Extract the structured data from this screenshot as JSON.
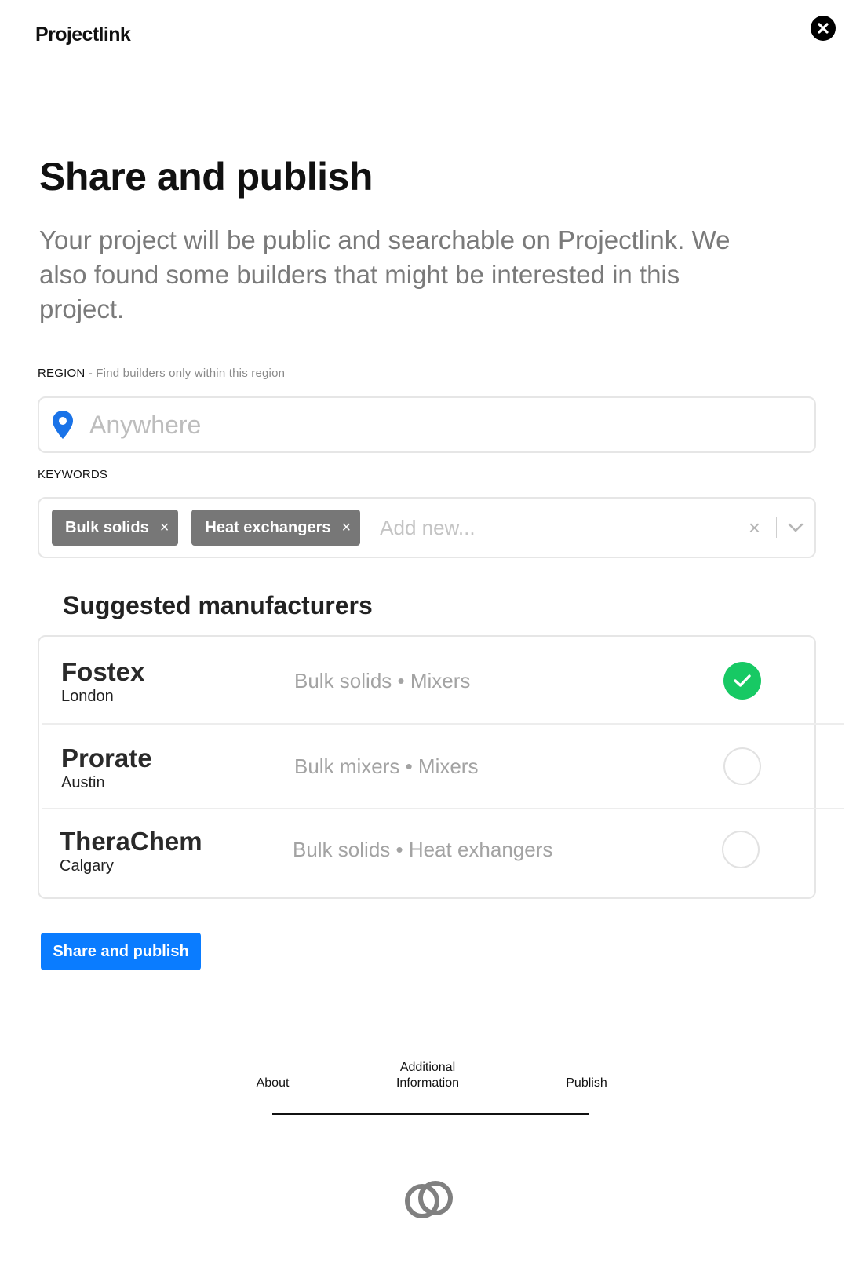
{
  "header": {
    "brand": "Projectlink",
    "close_icon": "close-circle-icon"
  },
  "page": {
    "title": "Share and publish",
    "subtitle": "Your project will be public and searchable on Projectlink. We also found some builders that might be interested in this project."
  },
  "region": {
    "label": "REGION",
    "hint": " - Find builders only within this region",
    "placeholder": "Anywhere",
    "value": "",
    "icon": "location-pin-icon"
  },
  "keywords": {
    "label": "KEYWORDS",
    "chips": [
      "Bulk solids",
      "Heat exchangers"
    ],
    "chip_remove": "×",
    "placeholder": "Add new...",
    "clear": "×"
  },
  "suggested": {
    "title": "Suggested manufacturers",
    "items": [
      {
        "name": "Fostex",
        "city": "London",
        "tags": "Bulk solids • Mixers",
        "selected": true
      },
      {
        "name": "Prorate",
        "city": "Austin",
        "tags": "Bulk mixers • Mixers",
        "selected": false
      },
      {
        "name": "TheraChem",
        "city": "Calgary",
        "tags": "Bulk solids • Heat exhangers",
        "selected": false
      }
    ]
  },
  "actions": {
    "publish_label": "Share and publish"
  },
  "steps": {
    "items": [
      "About",
      "Additional Information",
      "Publish"
    ]
  },
  "colors": {
    "accent": "#0a7cff",
    "selected": "#17c964",
    "chip": "#777777"
  }
}
